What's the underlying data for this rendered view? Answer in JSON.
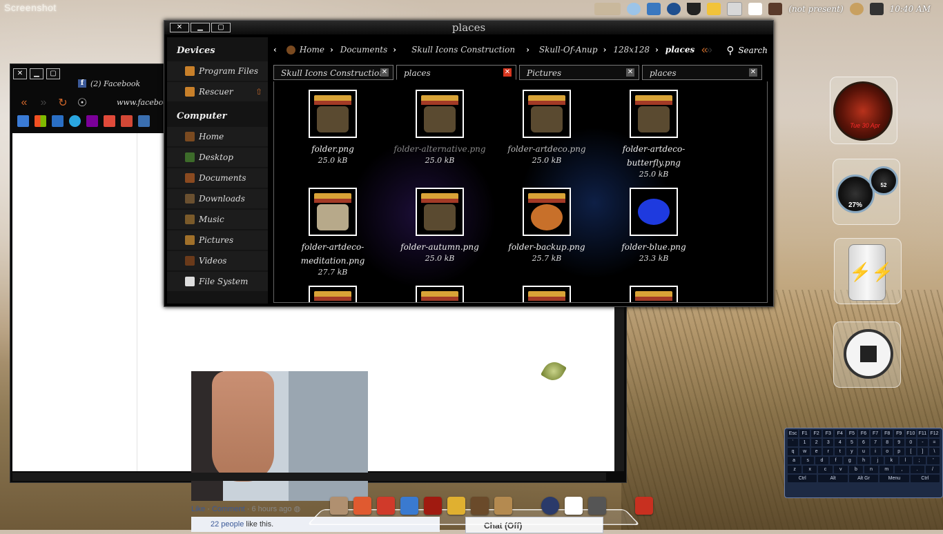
{
  "desktop": {
    "label": "Screenshot"
  },
  "tray": {
    "status_text": "(not present)",
    "time": "10:40 AM"
  },
  "browser": {
    "tab_title": "(2) Facebook",
    "url": "www.facebook.",
    "post_meta": {
      "like": "Like",
      "comment": "Comment",
      "time": "6 hours ago"
    },
    "likes_text_link": "22 people",
    "likes_text_rest": "like this.",
    "chat_label": "Chat (Off)"
  },
  "file_manager": {
    "title": "places",
    "sidebar": {
      "devices_heading": "Devices",
      "devices": [
        {
          "label": "Program Files",
          "color": "#c8802a"
        },
        {
          "label": "Rescuer",
          "color": "#c8802a"
        }
      ],
      "computer_heading": "Computer",
      "places": [
        {
          "label": "Home",
          "color": "#7a4a20"
        },
        {
          "label": "Desktop",
          "color": "#3d6b2a"
        },
        {
          "label": "Documents",
          "color": "#8a4a20"
        },
        {
          "label": "Downloads",
          "color": "#6a5030"
        },
        {
          "label": "Music",
          "color": "#7a5a2a"
        },
        {
          "label": "Pictures",
          "color": "#a0702a"
        },
        {
          "label": "Videos",
          "color": "#6a3a1a"
        },
        {
          "label": "File System",
          "color": "#dddddd"
        }
      ]
    },
    "breadcrumbs": [
      "Home",
      "Documents",
      "Skull Icons Construction",
      "Skull-Of-Anup",
      "128x128",
      "places"
    ],
    "search_label": "Search",
    "tabs": [
      {
        "label": "Skull Icons Construction"
      },
      {
        "label": "places"
      },
      {
        "label": "Pictures"
      },
      {
        "label": "places"
      }
    ],
    "files": [
      {
        "name": "folder.png",
        "size": "25.0 kB",
        "face": "#5a4a30"
      },
      {
        "name": "folder-alternative.png",
        "size": "25.0 kB",
        "face": "#5a4a30"
      },
      {
        "name": "folder-artdeco.png",
        "size": "25.0 kB",
        "face": "#5a4a30"
      },
      {
        "name": "folder-artdeco-butterfly.png",
        "size": "25.0 kB",
        "face": "#5a4a30"
      },
      {
        "name": "folder-artdeco-meditation.png",
        "size": "27.7 kB",
        "face": "#b7a98a"
      },
      {
        "name": "folder-autumn.png",
        "size": "25.0 kB",
        "face": "#5a4a30"
      },
      {
        "name": "folder-backup.png",
        "size": "25.7 kB",
        "face": "#c8702a"
      },
      {
        "name": "folder-blue.png",
        "size": "23.3 kB",
        "face": "#1e3adf"
      }
    ]
  },
  "widgets": {
    "clock_date": "Tue 30 Apr",
    "cpu_percent": "27%",
    "ram_value": "52"
  },
  "keyboard": {
    "rows": [
      [
        "Esc",
        "F1",
        "F2",
        "F3",
        "F4",
        "F5",
        "F6",
        "F7",
        "F8",
        "F9",
        "F10",
        "F11",
        "F12"
      ],
      [
        "`",
        "1",
        "2",
        "3",
        "4",
        "5",
        "6",
        "7",
        "8",
        "9",
        "0",
        "-",
        "="
      ],
      [
        "q",
        "w",
        "e",
        "r",
        "t",
        "y",
        "u",
        "i",
        "o",
        "p",
        "[",
        "]",
        "\\"
      ],
      [
        "a",
        "s",
        "d",
        "f",
        "g",
        "h",
        "j",
        "k",
        "l",
        ";",
        "'"
      ],
      [
        "z",
        "x",
        "c",
        "v",
        "b",
        "n",
        "m",
        ",",
        ".",
        "/"
      ],
      [
        "Ctrl",
        "Alt",
        "Alt Gr",
        "Menu",
        "Ctrl"
      ]
    ]
  }
}
